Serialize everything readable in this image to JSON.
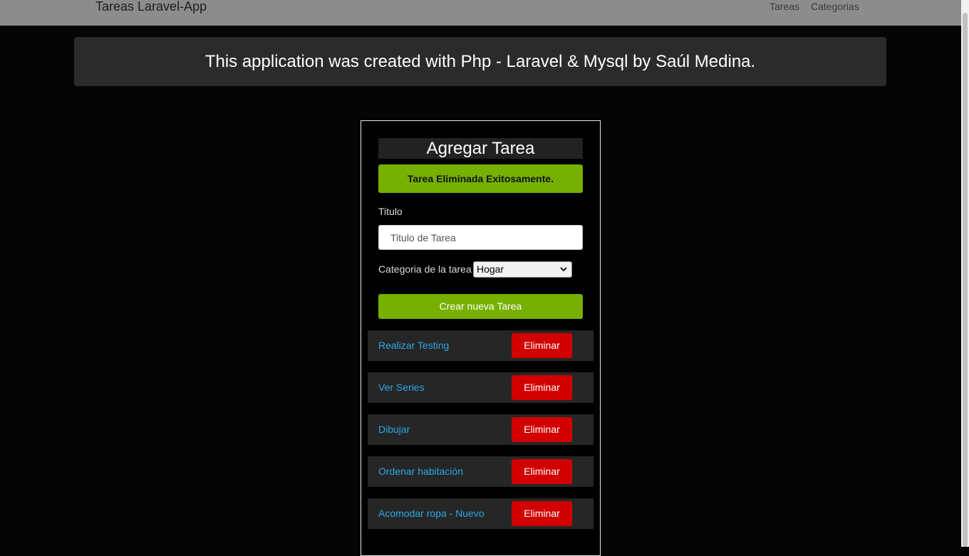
{
  "navbar": {
    "brand": "Tareas Laravel-App",
    "links": [
      "Tareas",
      "Categorias"
    ]
  },
  "banner": {
    "text": "This application was created with Php - Laravel & Mysql by Saúl Medina."
  },
  "form": {
    "title": "Agregar Tarea",
    "alert": "Tarea Eliminada Exitosamente.",
    "titulo_label": "Titulo",
    "titulo_placeholder": "Titulo de Tarea",
    "titulo_value": "",
    "categoria_label": "Categoria de la tarea",
    "categoria_selected": "Hogar",
    "submit_label": "Crear nueva Tarea"
  },
  "tasks": [
    {
      "title": "Realizar Testing",
      "delete_label": "Eliminar"
    },
    {
      "title": "Ver Series",
      "delete_label": "Eliminar"
    },
    {
      "title": "Dibujar",
      "delete_label": "Eliminar"
    },
    {
      "title": "Ordenar habitación",
      "delete_label": "Eliminar"
    },
    {
      "title": "Acomodar ropa - Nuevo",
      "delete_label": "Eliminar"
    }
  ],
  "icons": {
    "select_chevron": "chevron-down-icon"
  },
  "colors": {
    "navbar_bg": "#8c8c8c",
    "banner_bg": "#2b2b2b",
    "success_green": "#76b000",
    "danger_red": "#d20000",
    "link_blue": "#2aa7e6"
  }
}
